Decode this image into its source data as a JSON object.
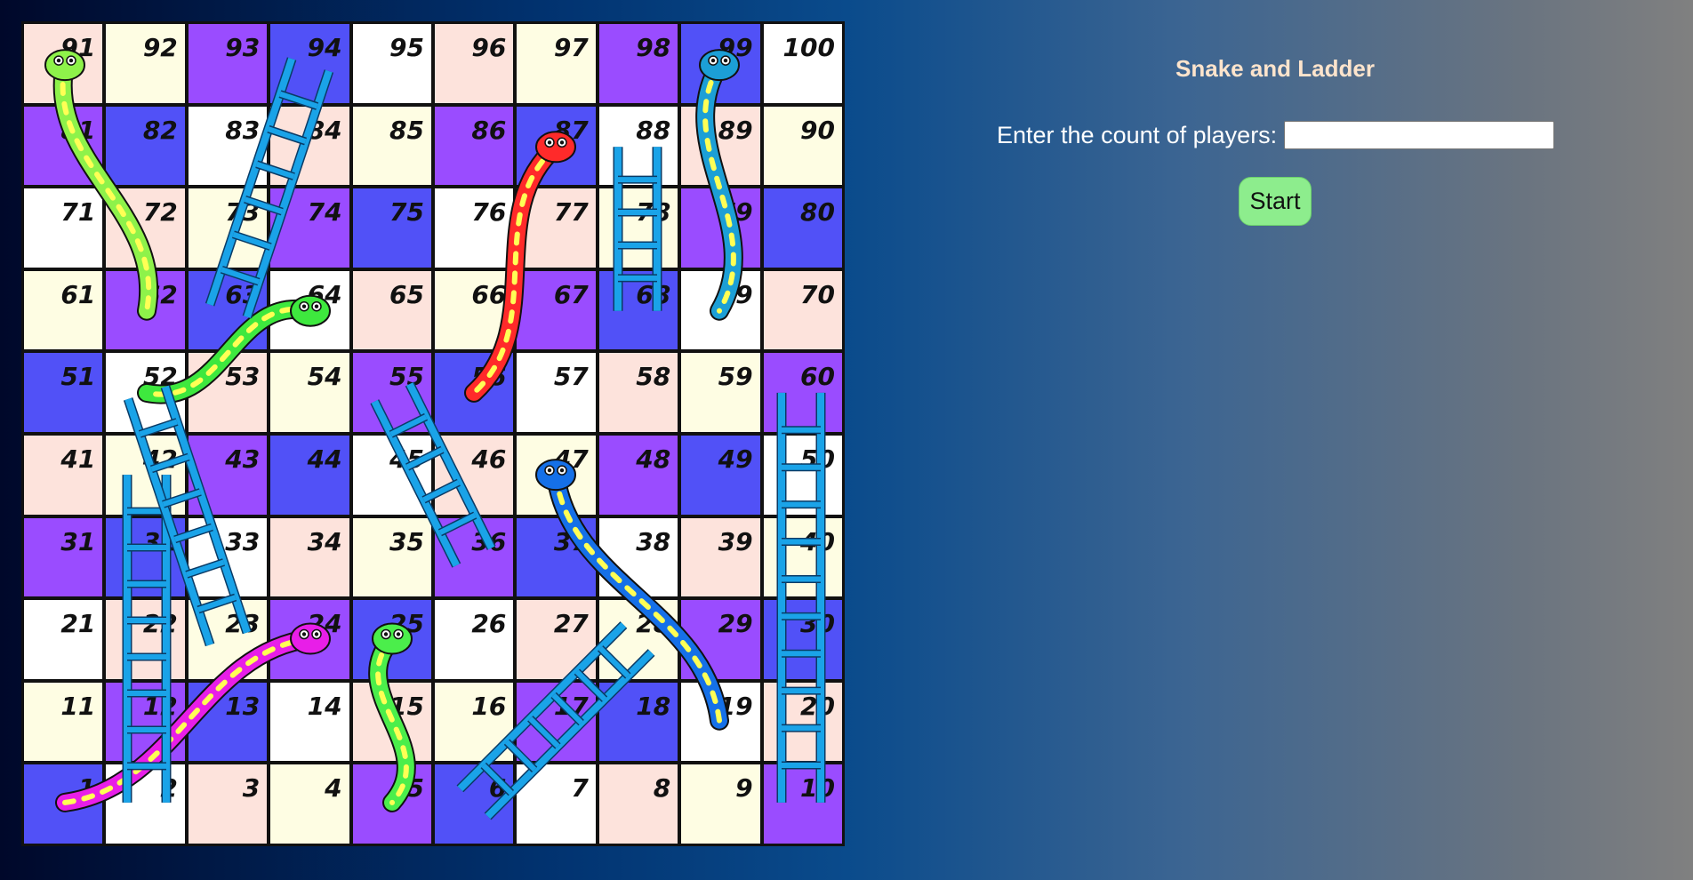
{
  "panel": {
    "title": "Snake and Ladder",
    "players_label": "Enter the count of players:",
    "players_value": "",
    "start_label": "Start"
  },
  "board": {
    "rows": [
      [
        91,
        92,
        93,
        94,
        95,
        96,
        97,
        98,
        99,
        100
      ],
      [
        81,
        82,
        83,
        84,
        85,
        86,
        87,
        88,
        89,
        90
      ],
      [
        71,
        72,
        73,
        74,
        75,
        76,
        77,
        78,
        79,
        80
      ],
      [
        61,
        62,
        63,
        64,
        65,
        66,
        67,
        68,
        69,
        70
      ],
      [
        51,
        52,
        53,
        54,
        55,
        56,
        57,
        58,
        59,
        60
      ],
      [
        41,
        42,
        43,
        44,
        45,
        46,
        47,
        48,
        49,
        50
      ],
      [
        31,
        32,
        33,
        34,
        35,
        36,
        37,
        38,
        39,
        40
      ],
      [
        21,
        22,
        23,
        24,
        25,
        26,
        27,
        28,
        29,
        30
      ],
      [
        11,
        12,
        13,
        14,
        15,
        16,
        17,
        18,
        19,
        20
      ],
      [
        1,
        2,
        3,
        4,
        5,
        6,
        7,
        8,
        9,
        10
      ]
    ],
    "cell_colors": [
      [
        "pink",
        "cream",
        "purple",
        "blue",
        "white",
        "pink",
        "cream",
        "purple",
        "blue",
        "white"
      ],
      [
        "purple",
        "blue",
        "white",
        "pink",
        "cream",
        "purple",
        "blue",
        "white",
        "pink",
        "cream"
      ],
      [
        "white",
        "pink",
        "cream",
        "purple",
        "blue",
        "white",
        "pink",
        "cream",
        "purple",
        "blue"
      ],
      [
        "cream",
        "purple",
        "blue",
        "white",
        "pink",
        "cream",
        "purple",
        "blue",
        "white",
        "pink"
      ],
      [
        "blue",
        "white",
        "pink",
        "cream",
        "purple",
        "blue",
        "white",
        "pink",
        "cream",
        "purple"
      ],
      [
        "pink",
        "cream",
        "purple",
        "blue",
        "white",
        "pink",
        "cream",
        "purple",
        "blue",
        "white"
      ],
      [
        "purple",
        "blue",
        "white",
        "pink",
        "cream",
        "purple",
        "blue",
        "white",
        "pink",
        "cream"
      ],
      [
        "white",
        "pink",
        "cream",
        "purple",
        "blue",
        "white",
        "pink",
        "cream",
        "purple",
        "blue"
      ],
      [
        "cream",
        "purple",
        "blue",
        "white",
        "pink",
        "cream",
        "purple",
        "blue",
        "white",
        "pink"
      ],
      [
        "blue",
        "white",
        "pink",
        "cream",
        "purple",
        "blue",
        "white",
        "pink",
        "cream",
        "purple"
      ]
    ],
    "ladders": [
      {
        "from": 2,
        "to": 42
      },
      {
        "from": 23,
        "to": 52
      },
      {
        "from": 36,
        "to": 55
      },
      {
        "from": 6,
        "to": 28
      },
      {
        "from": 63,
        "to": 94
      },
      {
        "from": 68,
        "to": 88
      },
      {
        "from": 10,
        "to": 60
      }
    ],
    "snakes": [
      {
        "head": 91,
        "tail": 62,
        "color": "#8ef24a"
      },
      {
        "head": 87,
        "tail": 56,
        "color": "#ff2a2a"
      },
      {
        "head": 99,
        "tail": 69,
        "color": "#1c9fd6"
      },
      {
        "head": 64,
        "tail": 52,
        "color": "#3ee83e"
      },
      {
        "head": 47,
        "tail": 19,
        "color": "#1570e8"
      },
      {
        "head": 24,
        "tail": 1,
        "color": "#e81ee8"
      },
      {
        "head": 25,
        "tail": 5,
        "color": "#4bee4b"
      }
    ],
    "colors": {
      "purple": "#9a4cff",
      "blue": "#5151f7",
      "white": "#ffffff",
      "pink": "#fde3dc",
      "cream": "#fefde3",
      "ladder": "#1aa3e8"
    }
  }
}
